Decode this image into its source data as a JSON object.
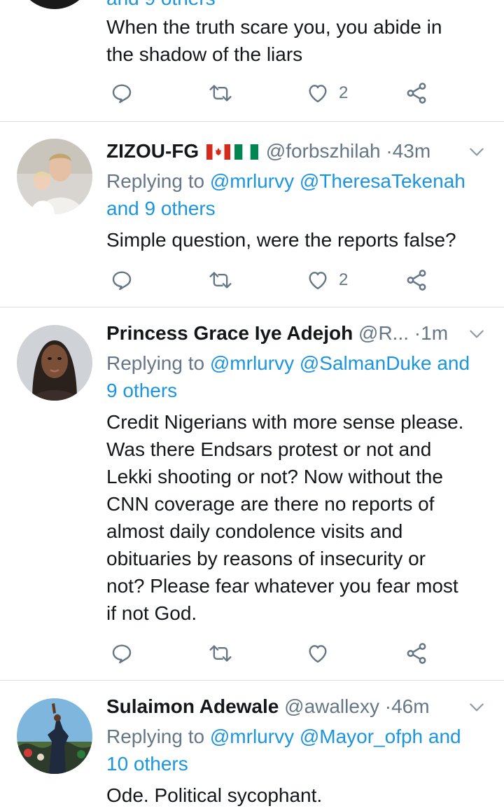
{
  "colors": {
    "link": "#1b95e0",
    "secondary": "#657786",
    "divider": "#d9dde1"
  },
  "top_tweet": {
    "reply_tail": "and 9 others",
    "text_lines": [
      "When the truth scare you, you abide in",
      "the shadow of the liars"
    ],
    "like_count": "2"
  },
  "tweets": [
    {
      "name": "ZIZOU-FG",
      "flags": [
        "canada-flag",
        "nigeria-flag"
      ],
      "handle": "@forbszhilah",
      "dot": "·",
      "time": "43m",
      "reply_prefix": "Replying to",
      "reply_line1": "@mrlurvy @TheresaTekenah",
      "reply_line2": "and 9 others",
      "text_lines": [
        "Simple question, were the reports false?"
      ],
      "like_count": "2"
    },
    {
      "name": "Princess Grace Iye Adejoh",
      "handle": "@R...",
      "dot": "·",
      "time": "1m",
      "reply_prefix": "Replying to",
      "reply_line1": "@mrlurvy @SalmanDuke and",
      "reply_line2": "9 others",
      "text_lines": [
        "Credit Nigerians with more sense please.",
        "Was there Endsars protest or not and",
        "Lekki shooting or not? Now without the",
        "CNN coverage are there no reports of",
        "almost daily condolence visits and",
        "obituaries by reasons of insecurity or",
        "not? Please fear whatever you fear most",
        "if not God."
      ],
      "like_count": ""
    },
    {
      "name": "Sulaimon Adewale",
      "handle": "@awallexy",
      "dot": "·",
      "time": "46m",
      "reply_prefix": "Replying to",
      "reply_line1": "@mrlurvy @Mayor_ofph and",
      "reply_line2": "10 others",
      "text_lines": [
        "Ode. Political sycophant."
      ]
    }
  ],
  "icons": [
    "reply-icon",
    "retweet-icon",
    "like-icon",
    "share-icon",
    "chevron-down-icon"
  ]
}
